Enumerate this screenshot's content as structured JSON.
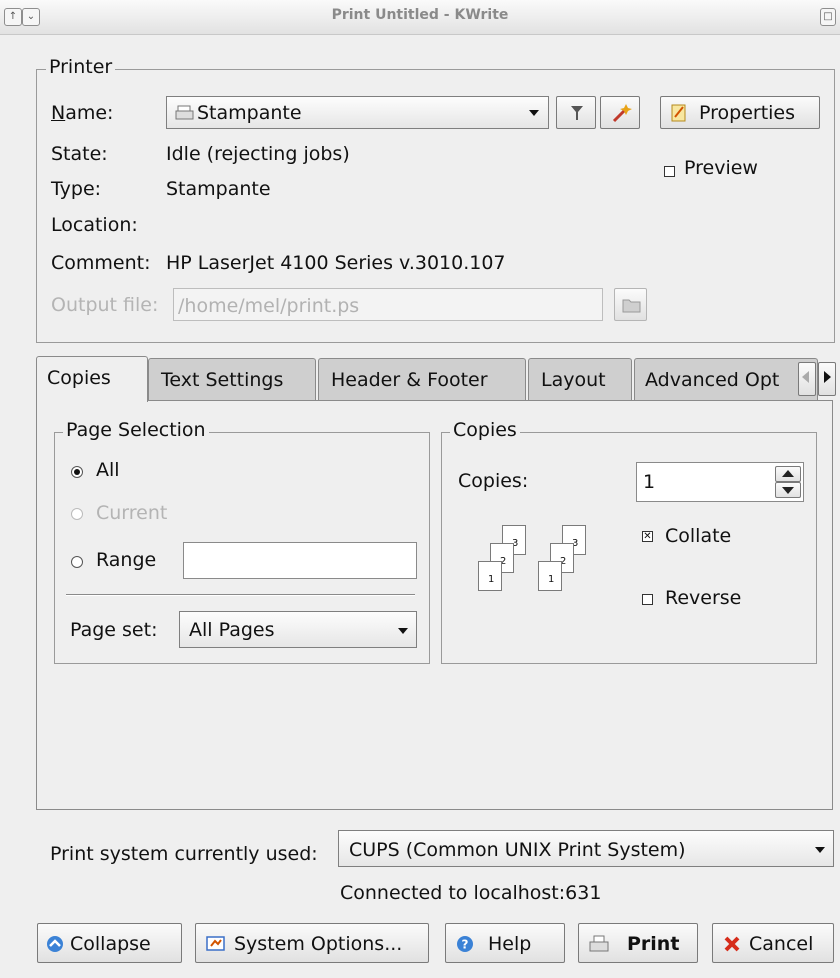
{
  "window": {
    "title": "Print Untitled - KWrite"
  },
  "printer": {
    "group_label": "Printer",
    "name_label": "Name:",
    "name_value": "Stampante",
    "properties_label": "Properties",
    "state_label": "State:",
    "state_value": "Idle (rejecting jobs)",
    "type_label": "Type:",
    "type_value": "Stampante",
    "location_label": "Location:",
    "location_value": "",
    "comment_label": "Comment:",
    "comment_value": "HP LaserJet 4100 Series v.3010.107",
    "output_label": "Output file:",
    "output_value": "/home/mel/print.ps",
    "preview_label": "Preview",
    "preview_checked": false
  },
  "tabs": [
    {
      "label": "Copies",
      "active": true
    },
    {
      "label": "Text Settings",
      "active": false
    },
    {
      "label": "Header & Footer",
      "active": false
    },
    {
      "label": "Layout",
      "active": false
    },
    {
      "label": "Advanced Opt",
      "active": false
    }
  ],
  "page_selection": {
    "group_label": "Page Selection",
    "all_label": "All",
    "current_label": "Current",
    "range_label": "Range",
    "range_value": "",
    "selected": "All",
    "page_set_label": "Page set:",
    "page_set_value": "All Pages"
  },
  "copies": {
    "group_label": "Copies",
    "copies_label": "Copies:",
    "copies_value": "1",
    "collate_label": "Collate",
    "collate_checked": true,
    "reverse_label": "Reverse",
    "reverse_checked": false,
    "page_numbers": [
      "1",
      "2",
      "3"
    ]
  },
  "print_system": {
    "label": "Print system currently used:",
    "value": "CUPS (Common UNIX Print System)",
    "connection": "Connected to localhost:631"
  },
  "buttons": {
    "collapse": "Collapse",
    "system_options": "System Options...",
    "help": "Help",
    "print": "Print",
    "cancel": "Cancel"
  }
}
